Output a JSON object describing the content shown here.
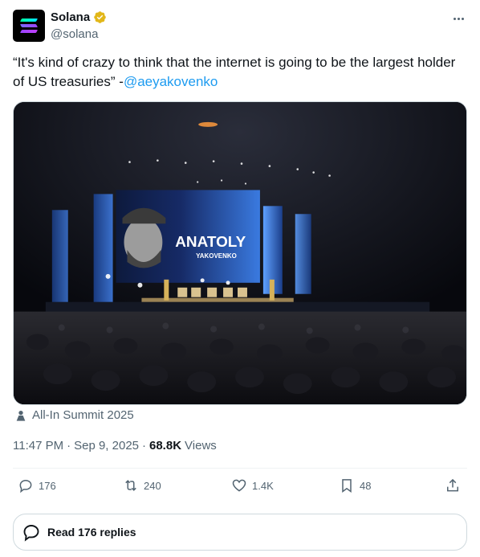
{
  "author": {
    "name": "Solana",
    "handle": "@solana",
    "verified_color": "#e2b719"
  },
  "tweet": {
    "text": "“It's kind of crazy to think that the internet is going to be the largest holder of US treasuries” -",
    "mention": "@aeyakovenko"
  },
  "media": {
    "screen_name_line1": "ANATOLY",
    "screen_name_line2": "YAKOVENKO"
  },
  "location": {
    "icon": "person-icon",
    "text": "All-In Summit 2025"
  },
  "meta": {
    "time": "11:47 PM",
    "date": "Sep 9, 2025",
    "views_count": "68.8K",
    "views_label": "Views",
    "separator": "·"
  },
  "actions": {
    "replies": "176",
    "reposts": "240",
    "likes": "1.4K",
    "bookmarks": "48"
  },
  "read_replies": {
    "label": "Read 176 replies"
  },
  "colors": {
    "accent": "#1d9bf0",
    "text_secondary": "#536471",
    "border": "#cfd9de"
  }
}
